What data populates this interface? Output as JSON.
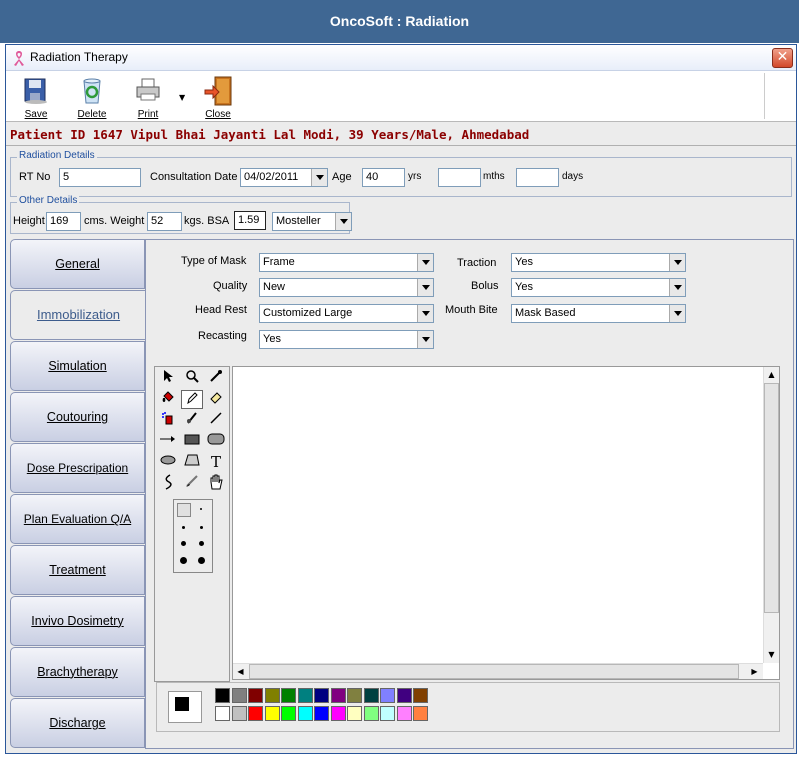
{
  "app_title": "OncoSoft : Radiation",
  "window": {
    "title": "Radiation Therapy",
    "close_label": "✕"
  },
  "toolbar": {
    "save": "Save",
    "delete": "Delete",
    "print": "Print",
    "close": "Close"
  },
  "patient_line": "Patient ID 1647 Vipul Bhai Jayanti Lal  Modi, 39 Years/Male, Ahmedabad",
  "radiation_details": {
    "legend": "Radiation Details",
    "rt_no_label": "RT No",
    "rt_no": "5",
    "consult_label": "Consultation Date",
    "consult_date": "04/02/2011",
    "age_label": "Age",
    "age": "40",
    "yrs": "yrs",
    "mths": "mths",
    "days": "days"
  },
  "other_details": {
    "legend": "Other Details",
    "height_label": "Height",
    "height": "169",
    "cms_weight_label": "cms. Weight",
    "weight": "52",
    "kgs_bsa_label": "kgs. BSA",
    "bsa": "1.59",
    "bsa_method": "Mosteller"
  },
  "tabs": [
    {
      "label": "General"
    },
    {
      "label": "Immobilization"
    },
    {
      "label": "Simulation"
    },
    {
      "label": "Coutouring"
    },
    {
      "label": "Dose Prescripation"
    },
    {
      "label": "Plan Evaluation Q/A"
    },
    {
      "label": "Treatment"
    },
    {
      "label": "Invivo Dosimetry"
    },
    {
      "label": "Brachytherapy"
    },
    {
      "label": "Discharge"
    }
  ],
  "form": {
    "type_of_mask_label": "Type of Mask",
    "type_of_mask": "Frame",
    "quality_label": "Quality",
    "quality": "New",
    "head_rest_label": "Head Rest",
    "head_rest": "Customized Large",
    "recasting_label": "Recasting",
    "recasting": "Yes",
    "traction_label": "Traction",
    "traction": "Yes",
    "bolus_label": "Bolus",
    "bolus": "Yes",
    "mouth_bite_label": "Mouth Bite",
    "mouth_bite": "Mask Based"
  },
  "paint_tools": {
    "text_tool": "T"
  },
  "palette": {
    "row1": [
      "#000000",
      "#808080",
      "#800000",
      "#808000",
      "#008000",
      "#008080",
      "#000080",
      "#800080",
      "#808040",
      "#004040",
      "#8080ff",
      "#400080",
      "#804000"
    ],
    "row2": [
      "#ffffff",
      "#c0c0c0",
      "#ff0000",
      "#ffff00",
      "#00ff00",
      "#00ffff",
      "#0000ff",
      "#ff00ff",
      "#ffffc0",
      "#80ff80",
      "#c0ffff",
      "#ff80ff",
      "#ff8040"
    ]
  }
}
